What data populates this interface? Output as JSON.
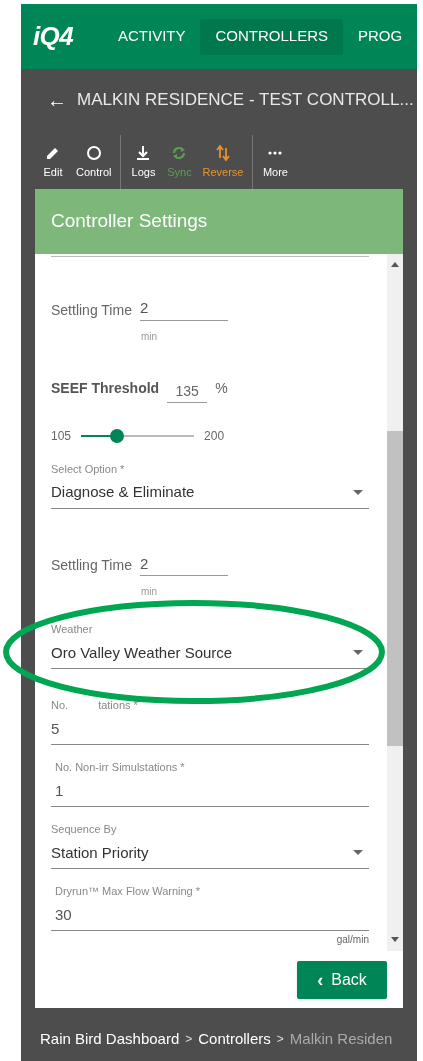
{
  "nav": {
    "logo": "iQ4",
    "tabs": [
      {
        "label": "ACTIVITY",
        "selected": false
      },
      {
        "label": "CONTROLLERS",
        "selected": true
      },
      {
        "label": "PROG",
        "selected": false
      }
    ]
  },
  "page_title": {
    "back_icon": "←",
    "title": "MALKIN RESIDENCE - TEST CONTROLL..."
  },
  "toolbar": [
    [
      {
        "kind": "edit",
        "label": "Edit",
        "color": "#ffffff"
      },
      {
        "kind": "control",
        "label": "Control",
        "color": "#ffffff"
      }
    ],
    [
      {
        "kind": "logs",
        "label": "Logs",
        "color": "#ffffff"
      },
      {
        "kind": "sync",
        "label": "Sync",
        "color": "#5c9e52"
      },
      {
        "kind": "reverse",
        "label": "Reverse",
        "color": "#e5932a"
      }
    ],
    [
      {
        "kind": "more",
        "label": "More",
        "color": "#ffffff"
      }
    ]
  ],
  "panel": {
    "title": "Controller Settings",
    "fields": [
      {
        "kind": "inline",
        "label": "Settling Time",
        "value": "2",
        "unit": "min"
      },
      {
        "kind": "threshold",
        "label": "SEEF Threshold",
        "value": "135",
        "unit": "%"
      },
      {
        "kind": "slider",
        "min": "105",
        "max": "200",
        "level": 0.32
      },
      {
        "kind": "select",
        "label": "Select Option *",
        "value": "Diagnose & Eliminate"
      },
      {
        "kind": "inline",
        "label": "Settling Time",
        "value": "2",
        "unit": "min"
      },
      {
        "kind": "select",
        "label": "Weather",
        "value": "Oro Valley Weather Source"
      },
      {
        "kind": "split_text",
        "label_parts": [
          "No.",
          "tations *"
        ],
        "value": "5"
      },
      {
        "kind": "text",
        "label": "No. Non-irr Simulstations *",
        "value": "1"
      },
      {
        "kind": "select",
        "label": "Sequence By",
        "value": "Station Priority"
      },
      {
        "kind": "text",
        "label": "Dryrun™ Max Flow Warning *",
        "value": "30",
        "unit": "gal/min"
      }
    ],
    "back_button": {
      "icon": "‹",
      "label": "Back"
    }
  },
  "breadcrumb": [
    {
      "label": "Rain Bird Dashboard",
      "current": false
    },
    {
      "separator": ">",
      "label": "Controllers",
      "current": false
    },
    {
      "separator": ">",
      "label": "Malkin Residen",
      "current": true
    }
  ]
}
